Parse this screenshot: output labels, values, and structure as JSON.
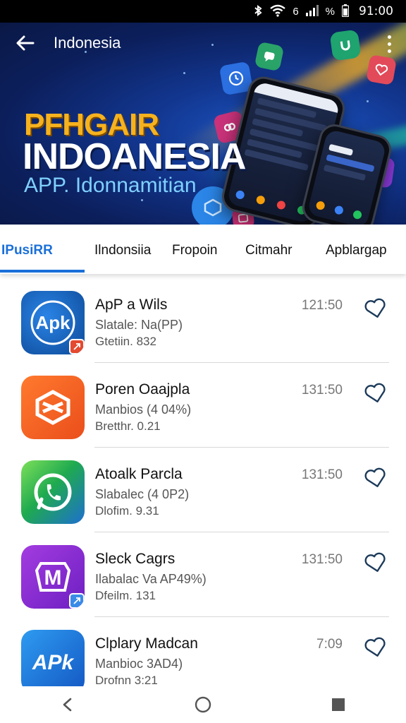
{
  "status_bar": {
    "icons": [
      "bluetooth-icon",
      "wifi-icon",
      "signal-icon",
      "battery-icon"
    ],
    "wifi_text": "6",
    "battery_text": "%",
    "time": "91:00"
  },
  "header": {
    "title": "Indonesia",
    "back_icon": "arrow-left-icon",
    "more_icon": "more-vertical-icon"
  },
  "hero": {
    "title_line1": "PFHGAIR",
    "title_line2": "INDOANESIA",
    "subtitle": "APP. Idonnamitian",
    "colors": {
      "accent_gold": "#f6b21e",
      "accent_cyan": "#7fd0ff",
      "background": "#12368f"
    }
  },
  "tabs": [
    {
      "label": "IPusiRR",
      "active": true
    },
    {
      "label": "Ilndonsiia",
      "active": false
    },
    {
      "label": "Fropoin",
      "active": false
    },
    {
      "label": "Citmahr",
      "active": false
    },
    {
      "label": "Apblargap",
      "active": false
    }
  ],
  "apps": [
    {
      "name": "ApP a Wils",
      "line2": "Slatale: Na(PP)",
      "line3": "Gtetiin. 832",
      "time": "121:50",
      "icon_text": "Apk",
      "icon_name": "app-logo-icon",
      "color": "#0f5fb3"
    },
    {
      "name": "Poren Oaajpla",
      "line2": "Manbios (4 04%)",
      "line3": "Bretthr. 0.21",
      "time": "131:50",
      "icon_text": "",
      "icon_name": "box-logo-icon",
      "color": "#f25a22"
    },
    {
      "name": "Atoalk Parcla",
      "line2": "Slabalec (4 0P2)",
      "line3": "Dlofim. 9.31",
      "time": "131:50",
      "icon_text": "",
      "icon_name": "phone-chat-icon",
      "color": "#2fb94b"
    },
    {
      "name": "Sleck Cagrs",
      "line2": "Ilabalac Va AP49%)",
      "line3": "Dfeilm. 131",
      "time": "131:50",
      "icon_text": "M",
      "icon_name": "m-logo-icon",
      "color": "#8b2bd1"
    },
    {
      "name": "Clplary Madcan",
      "line2": "Manbioc 3AD4)",
      "line3": "Drofnn 3:21",
      "time": "7:09",
      "icon_text": "APk",
      "icon_name": "apk-logo-icon",
      "color": "#1a78de"
    }
  ],
  "nav": {
    "back_icon": "nav-back-icon",
    "home_icon": "nav-home-icon",
    "recents_icon": "nav-recents-icon"
  }
}
